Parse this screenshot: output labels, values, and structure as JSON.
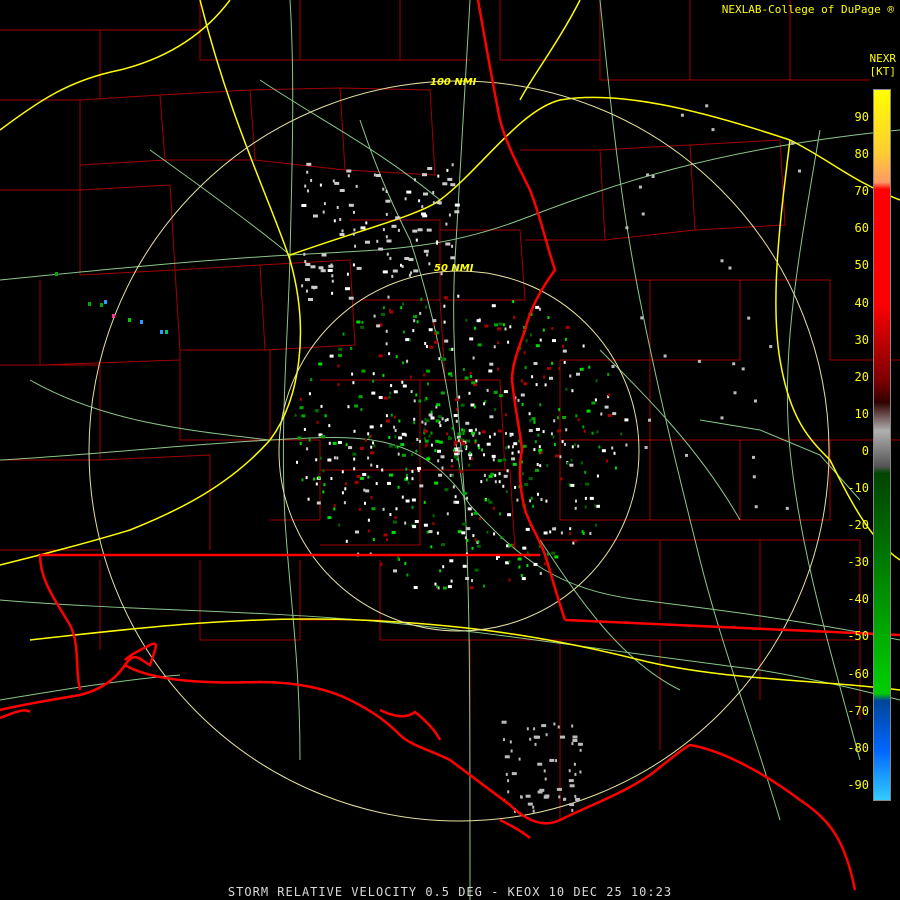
{
  "header": {
    "credit": "NEXLAB-College of DuPage",
    "credit_mark": "®",
    "product_code": "NEXR",
    "units": "[KT]"
  },
  "legend": {
    "ticks": [
      "90",
      "80",
      "70",
      "60",
      "50",
      "40",
      "30",
      "20",
      "10",
      "0",
      "-10",
      "-20",
      "-30",
      "-40",
      "-50",
      "-60",
      "-70",
      "-80",
      "-90"
    ],
    "colors": {
      "outbound_high": "#ffff00",
      "outbound_mid": "#ff0000",
      "outbound_low": "#7a0000",
      "near_zero": "#b0b0b0",
      "inbound_low": "#006600",
      "inbound_mid": "#00cc00",
      "inbound_high": "#0066ff"
    }
  },
  "range_rings": {
    "inner_label": "50 NMI",
    "outer_label": "100 NMI"
  },
  "footer": {
    "caption": "STORM RELATIVE VELOCITY 0.5 DEG - KEOX 10 DEC 25 10:23"
  },
  "colors": {
    "background": "#000000",
    "state_border": "#ff0000",
    "county_border": "#a00000",
    "interstate": "#ffff00",
    "highway": "#99dd99",
    "range_ring": "#e6e0a0"
  }
}
